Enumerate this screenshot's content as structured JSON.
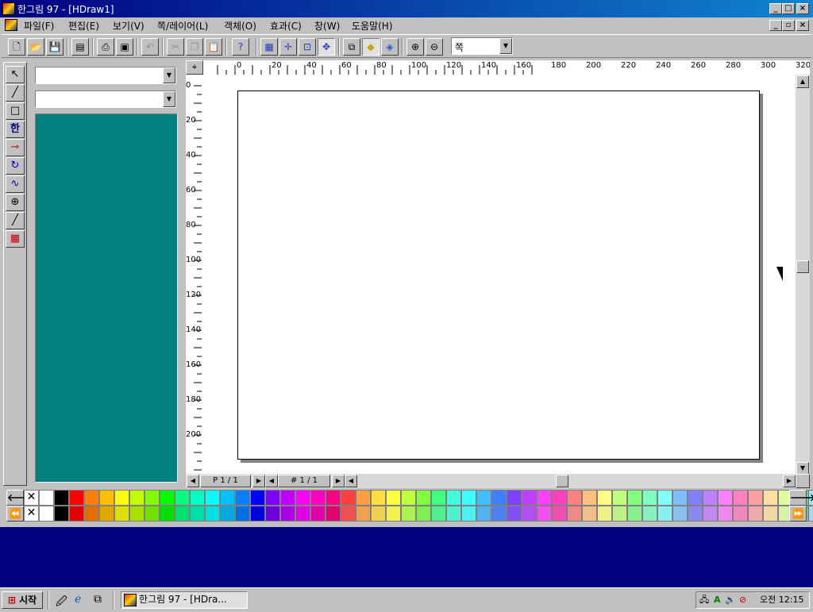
{
  "window": {
    "title": "한그림 97 - [HDraw1]"
  },
  "menus": [
    "파일(F)",
    "편집(E)",
    "보기(V)",
    "쪽/레이어(L)",
    "객체(O)",
    "효과(C)",
    "창(W)",
    "도움말(H)"
  ],
  "toolbar": {
    "zoom_value": "쪽",
    "buttons": [
      "new-icon",
      "open-icon",
      "save-icon",
      "clipboard-icon",
      "print-icon",
      "print-preview-icon",
      "undo-icon",
      "cut-icon",
      "copy-icon",
      "paste-icon",
      "help-pointer-icon",
      "grid-icon",
      "guide-icon",
      "snap-icon",
      "node-icon",
      "shape-outline-icon",
      "fill-icon",
      "fill-palette-icon",
      "zoom-in-icon",
      "zoom-out-icon"
    ]
  },
  "left_tools": [
    "select-icon",
    "line-icon",
    "rectangle-icon",
    "text-icon",
    "connector-icon",
    "rotate-icon",
    "bezier-icon",
    "zoom-icon",
    "pen-icon",
    "palette-icon"
  ],
  "ruler": {
    "h_labels": [
      "0",
      "20",
      "40",
      "60",
      "80",
      "100",
      "120",
      "140",
      "160",
      "180",
      "200",
      "220",
      "240",
      "260",
      "280",
      "300",
      "320"
    ],
    "v_labels": [
      "0",
      "20",
      "40",
      "60",
      "80",
      "100",
      "120",
      "140",
      "160",
      "180",
      "200"
    ]
  },
  "status": {
    "page": "P 1 / 1",
    "layer": "# 1 / 1"
  },
  "palette_colors": {
    "row1": [
      "#ffffff",
      "#000000",
      "#ff0000",
      "#ff8000",
      "#ffbf00",
      "#ffff00",
      "#c0ff00",
      "#80ff00",
      "#00ff00",
      "#00ff80",
      "#00ffc0",
      "#00ffff",
      "#00c0ff",
      "#0080ff",
      "#0000ff",
      "#8000ff",
      "#c000ff",
      "#ff00ff",
      "#ff00c0",
      "#ff0080",
      "#ff4040",
      "#ff9f40",
      "#ffdf40",
      "#ffff40",
      "#bfff40",
      "#80ff40",
      "#40ff80",
      "#40ffdf",
      "#40ffff",
      "#40bfff",
      "#4080ff",
      "#8040ff",
      "#bf40ff",
      "#ff40ff",
      "#ff40bf",
      "#ff8080",
      "#ffbf80",
      "#ffff80",
      "#bfff80",
      "#80ff80",
      "#80ffbf",
      "#80ffff",
      "#80bfff",
      "#8080ff",
      "#bf80ff",
      "#ff80ff",
      "#ff80bf",
      "#ff9f9f",
      "#ffdf9f",
      "#dfff9f",
      "#9fffbf",
      "#9fdfff"
    ],
    "row2": [
      "#ffffff",
      "#000000",
      "#e00000",
      "#e07000",
      "#e0a800",
      "#e0e000",
      "#a8e000",
      "#70e000",
      "#00e000",
      "#00e070",
      "#00e0a8",
      "#00e0e0",
      "#00a8e0",
      "#0070e0",
      "#0000e0",
      "#7000e0",
      "#a800e0",
      "#e000e0",
      "#e000a8",
      "#e00070",
      "#f05050",
      "#f0a050",
      "#f0d050",
      "#f0f050",
      "#b0f050",
      "#80f050",
      "#50f090",
      "#50f0d0",
      "#50f0f0",
      "#50b0f0",
      "#5080f0",
      "#8050f0",
      "#b050f0",
      "#f050f0",
      "#f050b0",
      "#f08888",
      "#f0c088",
      "#f0f088",
      "#c0f088",
      "#88f088",
      "#88f0c0",
      "#88f0f0",
      "#88c0f0",
      "#8888f0",
      "#c088f0",
      "#f088f0",
      "#f088c0",
      "#f0a8a8",
      "#f0d8a8",
      "#d8f0a8",
      "#a8f0c0",
      "#a8d8f0"
    ]
  },
  "taskbar": {
    "start_label": "시작",
    "task_label": "한그림 97 - [HDra...",
    "clock": "오전 12:15"
  }
}
